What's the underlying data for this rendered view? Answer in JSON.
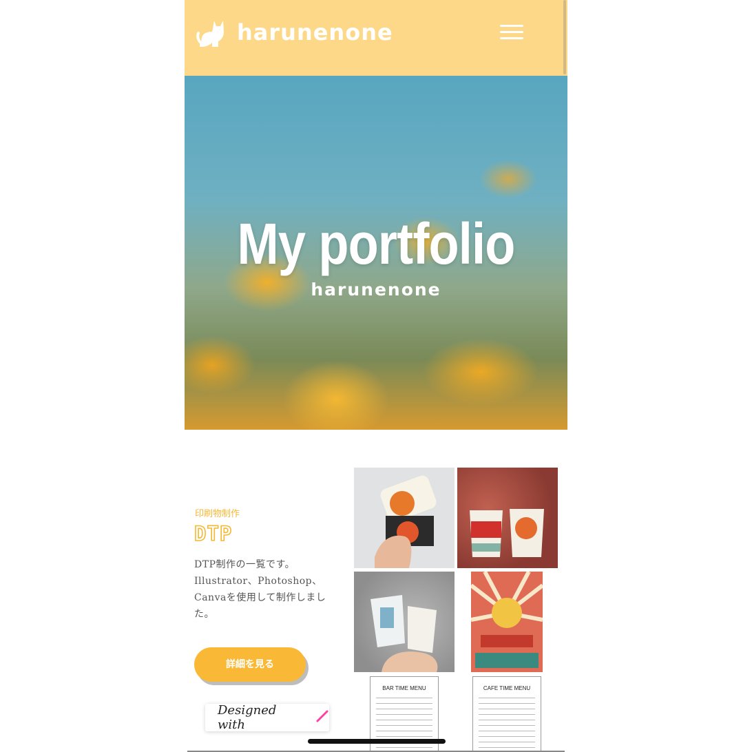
{
  "header": {
    "brand": "harunenone",
    "logo_icon": "cat-icon",
    "menu_icon": "hamburger-menu-icon",
    "background_color": "#fdd889"
  },
  "hero": {
    "title": "My portfolio",
    "subtitle": "harunenone"
  },
  "section": {
    "label": "印刷物制作",
    "title": "DTP",
    "description": "DTP制作の一覧です。Illustrator、Photoshop、Canvaを使用して制作しました。",
    "button_label": "詳細を見る",
    "accent_color": "#f9b936"
  },
  "gallery": {
    "menu1_title": "BAR TIME MENU",
    "menu2_title": "CAFE TIME MENU"
  },
  "badge": {
    "text": "Designed with",
    "icon": "pen-icon"
  }
}
